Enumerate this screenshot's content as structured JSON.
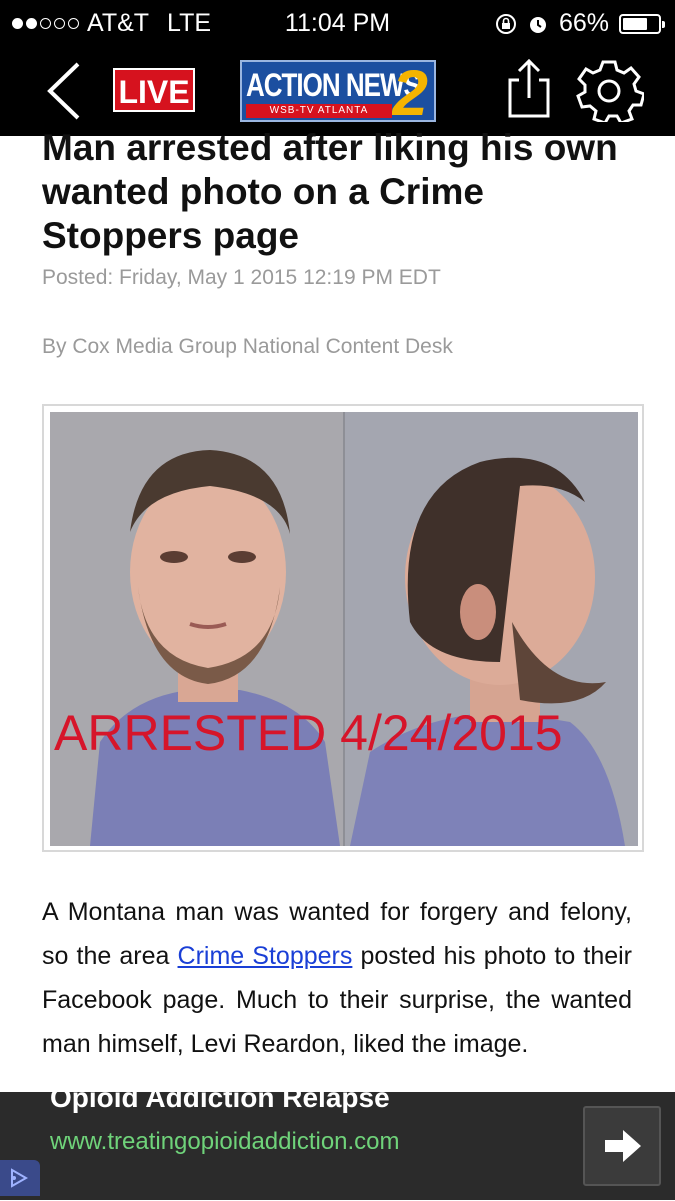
{
  "status_bar": {
    "carrier": "AT&T",
    "network": "LTE",
    "time": "11:04 PM",
    "battery": "66%",
    "signal_bars": 2,
    "icons": [
      "rotation-lock-icon",
      "alarm-icon",
      "battery-icon"
    ]
  },
  "nav": {
    "back_icon": "chevron-left-icon",
    "live_label": "LIVE",
    "logo_main": "ACTION NEWS",
    "logo_number": "2",
    "logo_sub": "WSB-TV ATLANTA",
    "share_icon": "share-icon",
    "settings_icon": "gear-icon"
  },
  "article": {
    "headline": "Man arrested after liking his own wanted photo on a Crime Stoppers page",
    "posted": "Posted: Friday, May 1 2015 12:19 PM EDT",
    "byline": "By Cox Media Group National Content Desk",
    "photo_caption_overlay": "ARRESTED 4/24/2015",
    "body_before_link": "A Montana man was wanted for forgery and felony, so the area ",
    "body_link": "Crime Stoppers",
    "body_after_link": " posted his photo to their Facebook page. Much to their surprise, the wanted man himself, Levi Reardon, liked the image."
  },
  "ad": {
    "title": "Opioid Addiction Relapse",
    "url": "www.treatingopioidaddiction.com",
    "arrow_icon": "arrow-right-icon"
  },
  "colors": {
    "live_red": "#d6121e",
    "link_blue": "#1a3fd6",
    "ad_url_green": "#6fd37a",
    "stamp_red": "#d6152a"
  }
}
